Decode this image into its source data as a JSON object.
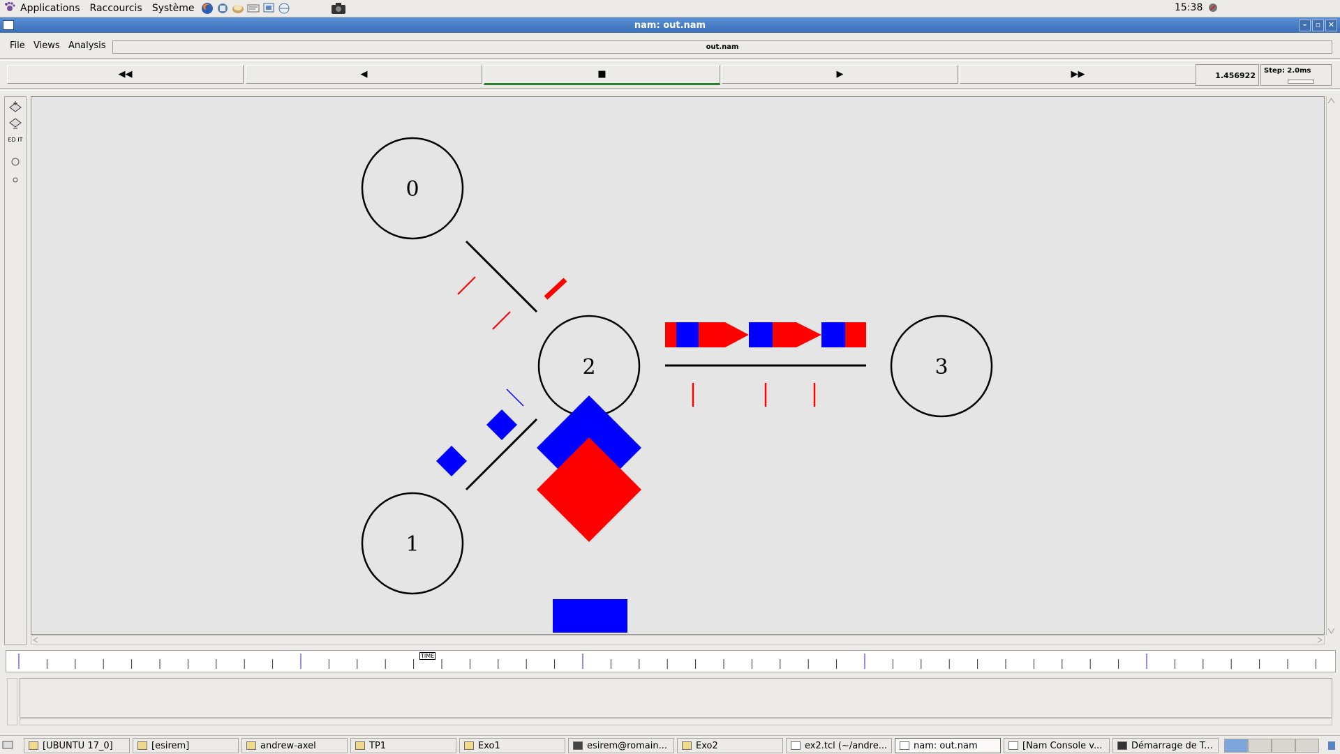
{
  "top_panel": {
    "menus": [
      "Applications",
      "Raccourcis",
      "Système"
    ],
    "clock": "15:38",
    "launchers": [
      "firefox-icon",
      "network-icon",
      "mail-icon",
      "editor-icon",
      "presentation-icon",
      "browser-icon"
    ]
  },
  "window": {
    "title": "nam: out.nam",
    "buttons": [
      "minimize",
      "maximize",
      "close"
    ]
  },
  "menubar": {
    "file": "File",
    "views": "Views",
    "analysis": "Analysis",
    "filename": "out.nam"
  },
  "toolbar": {
    "rewind": "◀◀",
    "back": "◀",
    "stop": "■",
    "play": "▶",
    "fast_forward": "▶▶",
    "time": "1.456922",
    "step": "Step: 2.0ms"
  },
  "left_tools": {
    "edit": "ED IT"
  },
  "topology": {
    "nodes": [
      {
        "id": "node-0",
        "label": "0"
      },
      {
        "id": "node-1",
        "label": "1"
      },
      {
        "id": "node-2",
        "label": "2"
      },
      {
        "id": "node-3",
        "label": "3"
      }
    ],
    "links": [
      "0-2",
      "1-2",
      "2-3"
    ],
    "colors": {
      "flow_red": "#ff0000",
      "flow_blue": "#0000ff",
      "background": "#e5e5e5"
    }
  },
  "timeline": {
    "marker": "TIME"
  },
  "taskbar": {
    "tasks": [
      "[UBUNTU 17_0]",
      "[esirem]",
      "andrew-axel",
      "TP1",
      "Exo1",
      "esirem@romain...",
      "Exo2",
      "ex2.tcl (~/andre...",
      "nam: out.nam",
      "[Nam Console v...",
      "Démarrage de T..."
    ],
    "active_task": "nam: out.nam"
  }
}
